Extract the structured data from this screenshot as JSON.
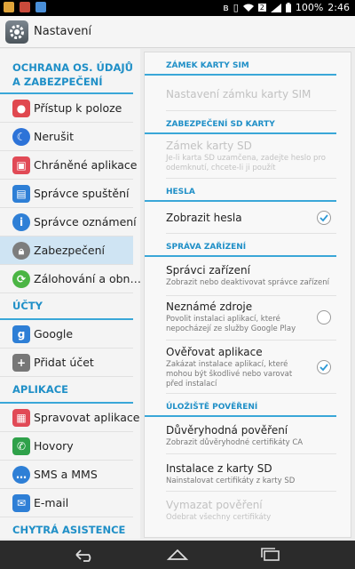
{
  "status_bar": {
    "battery": "100%",
    "time": "2:46",
    "icons": [
      "shield-icon",
      "flag-icon",
      "bar-icon",
      "bluetooth-icon",
      "vibrate-icon",
      "wifi-icon",
      "sim-icon",
      "signal-icon",
      "battery-icon"
    ]
  },
  "action_bar": {
    "title": "Nastavení",
    "icon": "settings-gear-icon"
  },
  "sidebar": {
    "cat_security": "OCHRANA OS. ÚDAJŮ A ZABEZPEČENÍ",
    "items1": [
      {
        "label": "Přístup k poloze",
        "icon": "location-icon",
        "color": "#e0484f"
      },
      {
        "label": "Nerušit",
        "icon": "moon-icon",
        "color": "#2d73d8"
      },
      {
        "label": "Chráněné aplikace",
        "icon": "protected-apps-icon",
        "color": "#e14a56"
      },
      {
        "label": "Správce spuštění",
        "icon": "startup-manager-icon",
        "color": "#2e7fd6"
      },
      {
        "label": "Správce oznámení",
        "icon": "notification-info-icon",
        "color": "#2e7fd6"
      },
      {
        "label": "Zabezpečení",
        "icon": "lock-icon",
        "color": "#7d7d7d"
      },
      {
        "label": "Zálohování a obn…",
        "icon": "backup-icon",
        "color": "#4bb544"
      }
    ],
    "cat_accounts": "ÚČTY",
    "items2": [
      {
        "label": "Google",
        "icon": "google-icon",
        "color": "#2e7fd6"
      },
      {
        "label": "Přidat účet",
        "icon": "plus-icon",
        "color": "#777777"
      }
    ],
    "cat_apps": "APLIKACE",
    "items3": [
      {
        "label": "Spravovat aplikace",
        "icon": "manage-apps-icon",
        "color": "#e14a56"
      },
      {
        "label": "Hovory",
        "icon": "phone-icon",
        "color": "#2fa14a"
      },
      {
        "label": "SMS a MMS",
        "icon": "sms-icon",
        "color": "#2e7fd6"
      },
      {
        "label": "E-mail",
        "icon": "email-icon",
        "color": "#2e7fd6"
      }
    ],
    "cat_smart": "CHYTRÁ ASISTENCE"
  },
  "panel": {
    "sec_sim": "ZÁMEK KARTY SIM",
    "sim_lock": "Nastavení zámku karty SIM",
    "sec_sd": "ZABEZPEČENÍ SD KARTY",
    "sd_lock": "Zámek karty SD",
    "sd_lock_sub": "Je-li karta SD uzamčena, zadejte heslo pro odemknutí, chcete-li ji použít",
    "sec_passwords": "HESLA",
    "show_passwords": "Zobrazit hesla",
    "sec_device": "SPRÁVA ZAŘÍZENÍ",
    "device_admins": "Správci zařízení",
    "device_admins_sub": "Zobrazit nebo deaktivovat správce zařízení",
    "unknown_sources": "Neznámé zdroje",
    "unknown_sources_sub": "Povolit instalaci aplikací, které nepocházejí ze služby Google Play",
    "verify_apps": "Ověřovat aplikace",
    "verify_apps_sub": "Zakázat instalace aplikací, které mohou být škodlivé nebo varovat před instalací",
    "sec_storage": "ÚLOŽIŠTĚ POVĚŘENÍ",
    "trusted": "Důvěryhodná pověření",
    "trusted_sub": "Zobrazit důvěryhodné certifikáty CA",
    "install_sd": "Instalace z karty SD",
    "install_sd_sub": "Nainstalovat certifikáty z karty SD",
    "clear": "Vymazat pověření",
    "clear_sub": "Odebrat všechny certifikáty"
  },
  "nav": {
    "icons": [
      "back-icon",
      "home-icon",
      "recents-icon"
    ]
  }
}
